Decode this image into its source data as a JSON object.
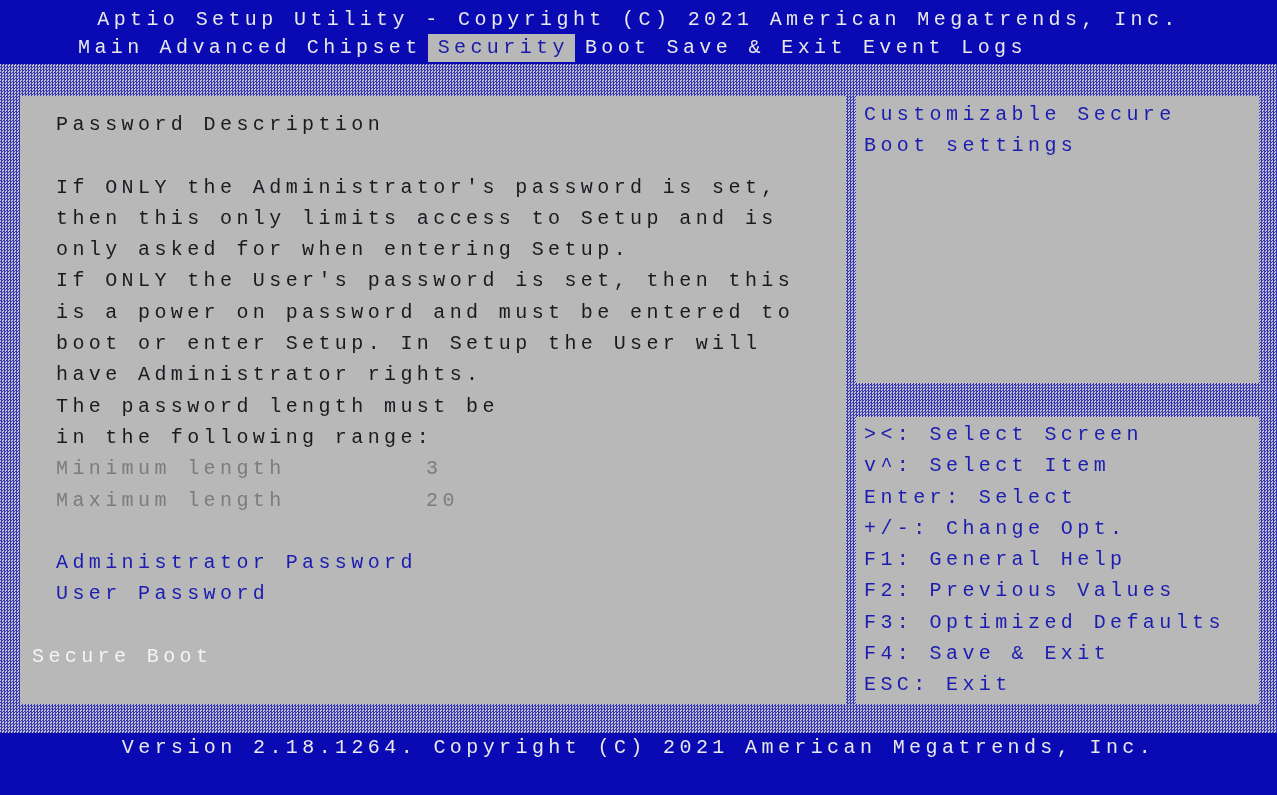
{
  "header": {
    "title": "Aptio Setup Utility - Copyright (C) 2021 American Megatrends, Inc."
  },
  "tabs": [
    {
      "label": "Main",
      "selected": false
    },
    {
      "label": "Advanced",
      "selected": false
    },
    {
      "label": "Chipset",
      "selected": false
    },
    {
      "label": "Security",
      "selected": true
    },
    {
      "label": "Boot",
      "selected": false
    },
    {
      "label": "Save & Exit",
      "selected": false
    },
    {
      "label": "Event Logs",
      "selected": false
    }
  ],
  "content": {
    "heading": "Password Description",
    "description": [
      "If ONLY the Administrator's password is set,",
      "then this only limits access to Setup and is",
      "only asked for when entering Setup.",
      "If ONLY the User's password is set, then this",
      "is a power on password and must be entered to",
      "boot or enter Setup. In Setup the User will",
      "have Administrator rights.",
      "The password length must be",
      "in the following range:"
    ],
    "settings": [
      {
        "label": "Minimum length",
        "value": "3",
        "disabled": true
      },
      {
        "label": "Maximum length",
        "value": "20",
        "disabled": true
      }
    ],
    "items": [
      {
        "label": "Administrator Password",
        "kind": "item",
        "selected": false
      },
      {
        "label": "User Password",
        "kind": "item",
        "selected": false
      },
      {
        "label": "Secure Boot",
        "kind": "submenu",
        "selected": true
      }
    ]
  },
  "help": {
    "lines": [
      "Customizable Secure",
      "Boot settings"
    ]
  },
  "keys": [
    "><: Select Screen",
    "v^: Select Item",
    "Enter: Select",
    "+/-: Change Opt.",
    "F1: General Help",
    "F2: Previous Values",
    "F3: Optimized Defaults",
    "F4: Save & Exit",
    "ESC: Exit"
  ],
  "footer": {
    "version": "Version 2.18.1264. Copyright (C) 2021 American Megatrends, Inc."
  }
}
